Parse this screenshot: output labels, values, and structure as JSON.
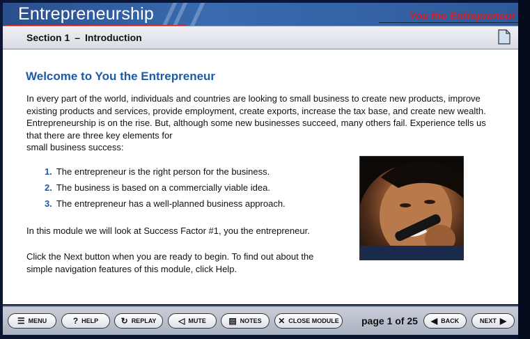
{
  "app": {
    "title": "Entrepreneurship",
    "brand": "You the Entrepreneur"
  },
  "section": {
    "label": "Section 1",
    "separator": "–",
    "name": "Introduction",
    "icon": "document-icon"
  },
  "main": {
    "heading": "Welcome to You the Entrepreneur",
    "intro": "In every part of the world, individuals and countries are looking to small business to create new products, improve existing products and services, provide employment, create exports, increase the tax base, and create new wealth. Entrepreneurship is on the rise. But, although some new businesses succeed, many others fail. Experience tells us that there are three key elements for",
    "intro_tail": "small business success:",
    "key_elements": [
      {
        "num": "1.",
        "text": "The entrepreneur is the right person for the business."
      },
      {
        "num": "2.",
        "text": "The business is based on a commercially viable idea."
      },
      {
        "num": "3.",
        "text": "The entrepreneur has a well-planned business approach."
      }
    ],
    "paragraph_2": "In this module we will look at Success Factor #1, you the entrepreneur.",
    "paragraph_3": "Click the Next button when you are ready to begin. To find out about the simple navigation features of this module, click Help.",
    "photo": "man-on-phone-photo"
  },
  "toolbar": {
    "menu": "MENU",
    "help": "HELP",
    "replay": "REPLAY",
    "mute": "MUTE",
    "notes": "NOTES",
    "close_module": "CLOSE MODULE",
    "page_info": "page 1 of 25",
    "back": "BACK",
    "next": "NEXT"
  },
  "colors": {
    "heading": "#1a5ca8",
    "brand": "#d41f1f",
    "titlebar": "#2e5a9a"
  }
}
